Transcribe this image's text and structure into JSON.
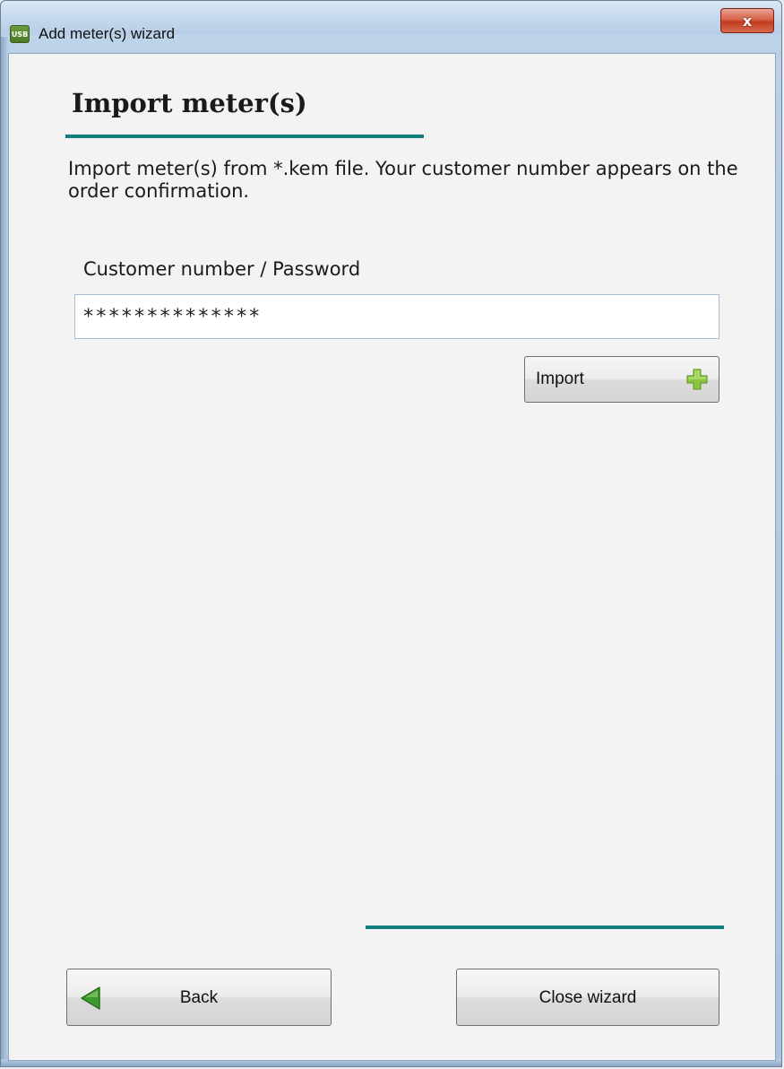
{
  "window": {
    "title": "Add meter(s) wizard",
    "app_icon_text": "USB",
    "close_glyph": "x"
  },
  "page": {
    "title": "Import meter(s)",
    "description": "Import meter(s) from *.kem file. Your customer number appears on the order confirmation.",
    "field_label": "Customer number / Password",
    "password_value": "**************",
    "import_label": "Import"
  },
  "footer": {
    "back_label": "Back",
    "close_label": "Close wizard"
  },
  "colors": {
    "accent_rule": "#117c7a",
    "plus_green": "#8bc53f",
    "back_arrow_green": "#3f9a2d"
  },
  "icons": {
    "import": "plus-icon",
    "back": "back-arrow-icon",
    "close": "close-icon",
    "app": "app-icon"
  }
}
